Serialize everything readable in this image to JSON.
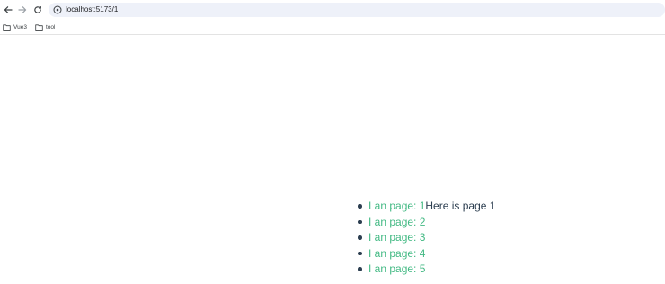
{
  "browser": {
    "url": "localhost:5173/1",
    "bookmarks": [
      {
        "label": "Vue3",
        "icon": "folder-icon"
      },
      {
        "label": "tool",
        "icon": "folder-icon"
      }
    ]
  },
  "page": {
    "links": [
      {
        "label": "I an page: 1",
        "content": "Here is page 1"
      },
      {
        "label": "I an page: 2"
      },
      {
        "label": "I an page: 3"
      },
      {
        "label": "I an page: 4"
      },
      {
        "label": "I an page: 5"
      }
    ]
  },
  "colors": {
    "link": "#42b983",
    "text": "#2c3e50",
    "omnibox": "#eef1f9"
  }
}
